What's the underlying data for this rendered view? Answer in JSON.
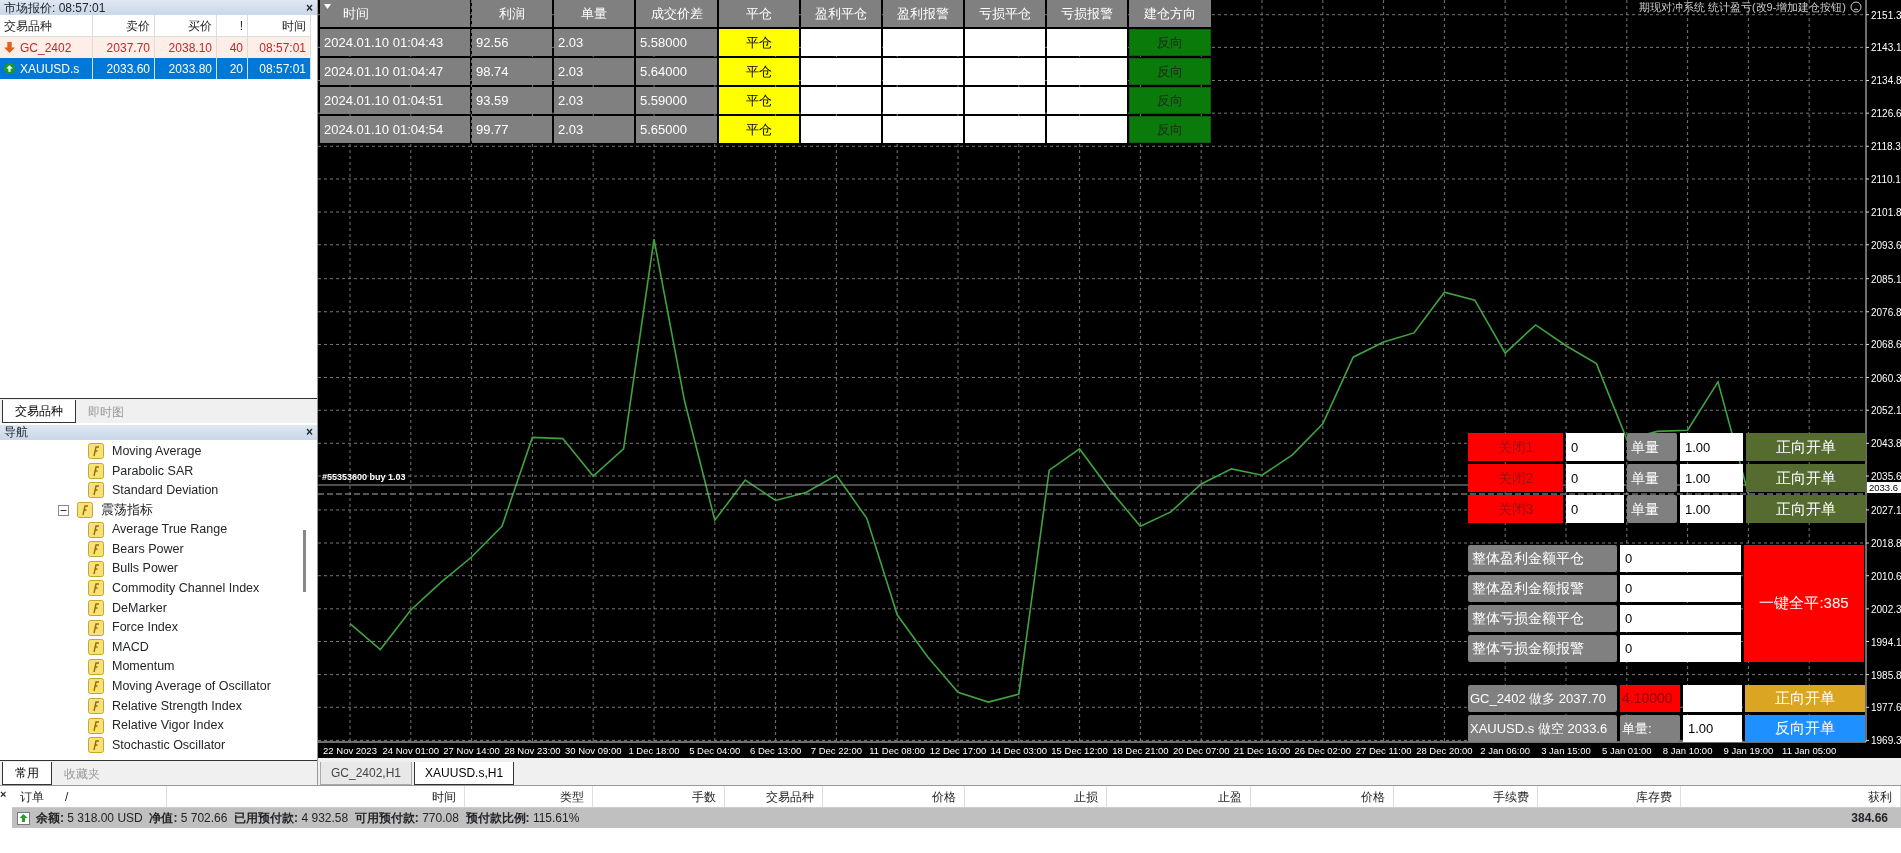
{
  "market_watch": {
    "title": "市场报价: 08:57:01",
    "close_icon": "×",
    "columns": [
      "交易品种",
      "卖价",
      "买价",
      "!",
      "时间"
    ],
    "rows": [
      {
        "symbol": "GC_2402",
        "bid": "2037.70",
        "ask": "2038.10",
        "spread": "40",
        "time": "08:57:01",
        "kind": "down",
        "selected": false
      },
      {
        "symbol": "XAUUSD.s",
        "bid": "2033.60",
        "ask": "2033.80",
        "spread": "20",
        "time": "08:57:01",
        "kind": "up",
        "selected": true
      }
    ],
    "tabs": [
      {
        "label": "交易品种",
        "selected": true
      },
      {
        "label": "即时图",
        "selected": false
      }
    ]
  },
  "navigator": {
    "title": "导航",
    "close_icon": "×",
    "tree": [
      {
        "children": [
          {
            "label": "Moving Average"
          },
          {
            "label": "Parabolic SAR"
          },
          {
            "label": "Standard Deviation"
          }
        ]
      },
      {
        "label": "震荡指标",
        "expanded": true,
        "children": [
          {
            "label": "Average True Range"
          },
          {
            "label": "Bears Power"
          },
          {
            "label": "Bulls Power"
          },
          {
            "label": "Commodity Channel Index"
          },
          {
            "label": "DeMarker"
          },
          {
            "label": "Force Index"
          },
          {
            "label": "MACD"
          },
          {
            "label": "Momentum"
          },
          {
            "label": "Moving Average of Oscillator"
          },
          {
            "label": "Relative Strength Index"
          },
          {
            "label": "Relative Vigor Index"
          },
          {
            "label": "Stochastic Oscillator"
          }
        ]
      }
    ],
    "tabs": [
      {
        "label": "常用",
        "selected": true
      },
      {
        "label": "收藏夹",
        "selected": false
      }
    ]
  },
  "chart": {
    "title": "期现对冲系统 统计盈亏(改9-增加建仓按钮)",
    "order_line": "#55353600 buy 1.03",
    "price_tag": "2033.6",
    "chart_data": {
      "type": "line",
      "grid": true,
      "categories": [
        "22 Nov 2023",
        null,
        "24 Nov 01:00",
        null,
        "27 Nov 14:00",
        null,
        "28 Nov 23:00",
        null,
        "30 Nov 09:00",
        null,
        "1 Dec 18:00",
        null,
        "5 Dec 04:00",
        null,
        "6 Dec 13:00",
        null,
        "7 Dec 22:00",
        null,
        "11 Dec 08:00",
        null,
        "12 Dec 17:00",
        null,
        "14 Dec 03:00",
        null,
        "15 Dec 12:00",
        null,
        "18 Dec 21:00",
        null,
        "20 Dec 07:00",
        null,
        "21 Dec 16:00",
        null,
        "26 Dec 02:00",
        null,
        "27 Dec 11:00",
        null,
        "28 Dec 20:00",
        null,
        "2 Jan 06:00",
        null,
        "3 Jan 15:00",
        null,
        "5 Jan 01:00",
        null,
        "8 Jan 10:00",
        null,
        "9 Jan 19:00",
        null,
        "11 Jan 05:00",
        null
      ],
      "series": [
        {
          "color": "#3fa33f",
          "values": [
            1998.6,
            1992.1,
            2002.0,
            2009.0,
            2015.3,
            2023.0,
            2045.3,
            2045.0,
            2035.6,
            2042.4,
            2095.0,
            2054.6,
            2024.5,
            2034.6,
            2029.5,
            2031.5,
            2035.8,
            2025.0,
            2000.8,
            1990.3,
            1981.4,
            1978.9,
            1980.9,
            2037.1,
            2042.4,
            2032.1,
            2023.0,
            2026.6,
            2033.6,
            2037.4,
            2035.8,
            2040.9,
            2048.7,
            2065.4,
            2069.2,
            2071.5,
            2081.7,
            2079.7,
            2066.4,
            2073.5,
            2068.3,
            2063.8,
            2044.8,
            2046.8,
            2047.1,
            2059.2,
            2031.1,
            null,
            null,
            null
          ]
        }
      ],
      "ylim": [
        1969.3,
        2151.3
      ],
      "yticks": [
        2151.3,
        2143.1,
        2134.8,
        2126.6,
        2118.3,
        2110.1,
        2101.8,
        2093.6,
        2085.1,
        2076.8,
        2068.6,
        2060.3,
        2052.1,
        2043.8,
        2035.6,
        2027.1,
        2018.8,
        2010.6,
        2002.3,
        1994.1,
        1985.8,
        1977.6,
        1969.3
      ]
    },
    "tabs": [
      {
        "label": "GC_2402,H1",
        "selected": false
      },
      {
        "label": "XAUUSD.s,H1",
        "selected": true
      }
    ]
  },
  "orders_table": {
    "columns": [
      "时间",
      "利润",
      "单量",
      "成交价差",
      "平仓",
      "盈利平仓",
      "盈利报警",
      "亏损平仓",
      "亏损报警",
      "建仓方向"
    ],
    "rows": [
      {
        "time": "2024.01.10 01:04:43",
        "profit": "92.56",
        "lots": "2.03",
        "spread": "5.58000",
        "close": "平仓",
        "direction": "反向"
      },
      {
        "time": "2024.01.10 01:04:47",
        "profit": "98.74",
        "lots": "2.03",
        "spread": "5.64000",
        "close": "平仓",
        "direction": "反向"
      },
      {
        "time": "2024.01.10 01:04:51",
        "profit": "93.59",
        "lots": "2.03",
        "spread": "5.59000",
        "close": "平仓",
        "direction": "反向"
      },
      {
        "time": "2024.01.10 01:04:54",
        "profit": "99.77",
        "lots": "2.03",
        "spread": "5.65000",
        "close": "平仓",
        "direction": "反向"
      }
    ]
  },
  "control_panel": {
    "close_rows": [
      {
        "close": "关闭1",
        "amount": "0",
        "lot_label": "单量",
        "lot": "1.00",
        "open": "正向开单"
      },
      {
        "close": "关闭2",
        "amount": "0",
        "lot_label": "单量",
        "lot": "1.00",
        "open": "正向开单"
      },
      {
        "close": "关闭3",
        "amount": "0",
        "lot_label": "单量",
        "lot": "1.00",
        "open": "正向开单"
      }
    ],
    "totals": [
      {
        "label": "整体盈利金额平仓",
        "value": "0"
      },
      {
        "label": "整体盈利金额报警",
        "value": "0"
      },
      {
        "label": "整体亏损金额平仓",
        "value": "0"
      },
      {
        "label": "整体亏损金额报警",
        "value": "0"
      }
    ],
    "close_all": "一键全平:385",
    "long_leg": {
      "label": "GC_2402 做多 2037.70",
      "spread": "4.10000",
      "button": "正向开单"
    },
    "short_leg": {
      "label": "XAUUSD.s 做空 2033.6",
      "lot_label": "单量:",
      "lot": "1.00",
      "button": "反向开单"
    }
  },
  "terminal": {
    "close_icon": "×",
    "columns": [
      "订单",
      "/",
      "时间",
      "类型",
      "手数",
      "交易品种",
      "价格",
      "止损",
      "止盈",
      "价格",
      "手续费",
      "库存费",
      "获利"
    ],
    "summary": "**余额:** 5 318.00 USD  **净值:** 5 702.66  **已用预付款:** 4 932.58  **可用预付款:** 770.08  **预付款比例:** 115.61%",
    "profit": "384.66"
  }
}
